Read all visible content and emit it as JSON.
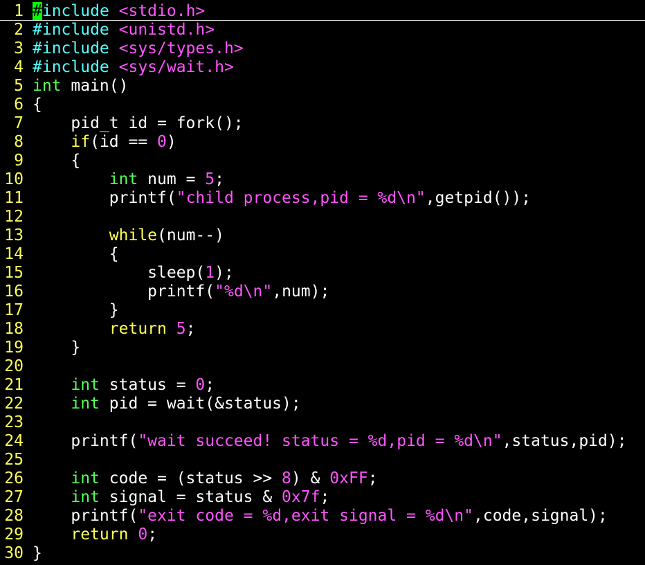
{
  "editor": {
    "theme": {
      "background": "#000000",
      "line_number": "#ffff55",
      "preproc": "#55ffff",
      "type": "#55ff55",
      "statement": "#ffff55",
      "string": "#ff55ff",
      "number": "#ff55ff",
      "normal": "#ffffff",
      "cursor": "#00ff00"
    },
    "cursor_line": 1,
    "lines": [
      {
        "n": "1",
        "tokens": [
          [
            "cursor",
            "#"
          ],
          [
            "pre",
            "include "
          ],
          [
            "str",
            "<stdio.h>"
          ]
        ]
      },
      {
        "n": "2",
        "tokens": [
          [
            "pre",
            "#include "
          ],
          [
            "str",
            "<unistd.h>"
          ]
        ]
      },
      {
        "n": "3",
        "tokens": [
          [
            "pre",
            "#include "
          ],
          [
            "str",
            "<sys/types.h>"
          ]
        ]
      },
      {
        "n": "4",
        "tokens": [
          [
            "pre",
            "#include "
          ],
          [
            "str",
            "<sys/wait.h>"
          ]
        ]
      },
      {
        "n": "5",
        "tokens": [
          [
            "type",
            "int"
          ],
          [
            "norm",
            " main()"
          ]
        ]
      },
      {
        "n": "6",
        "tokens": [
          [
            "norm",
            "{"
          ]
        ]
      },
      {
        "n": "7",
        "tokens": [
          [
            "norm",
            "    pid_t id = fork();"
          ]
        ]
      },
      {
        "n": "8",
        "tokens": [
          [
            "norm",
            "    "
          ],
          [
            "stmt",
            "if"
          ],
          [
            "norm",
            "(id == "
          ],
          [
            "num",
            "0"
          ],
          [
            "norm",
            ")"
          ]
        ]
      },
      {
        "n": "9",
        "tokens": [
          [
            "norm",
            "    {"
          ]
        ]
      },
      {
        "n": "10",
        "tokens": [
          [
            "norm",
            "        "
          ],
          [
            "type",
            "int"
          ],
          [
            "norm",
            " num = "
          ],
          [
            "num",
            "5"
          ],
          [
            "norm",
            ";"
          ]
        ]
      },
      {
        "n": "11",
        "tokens": [
          [
            "norm",
            "        printf("
          ],
          [
            "str",
            "\"child process,pid = "
          ],
          [
            "num",
            "%d\\n"
          ],
          [
            "str",
            "\""
          ],
          [
            "norm",
            ",getpid());"
          ]
        ]
      },
      {
        "n": "12",
        "tokens": []
      },
      {
        "n": "13",
        "tokens": [
          [
            "norm",
            "        "
          ],
          [
            "stmt",
            "while"
          ],
          [
            "norm",
            "(num--)"
          ]
        ]
      },
      {
        "n": "14",
        "tokens": [
          [
            "norm",
            "        {"
          ]
        ]
      },
      {
        "n": "15",
        "tokens": [
          [
            "norm",
            "            sleep("
          ],
          [
            "num",
            "1"
          ],
          [
            "norm",
            ");"
          ]
        ]
      },
      {
        "n": "16",
        "tokens": [
          [
            "norm",
            "            printf("
          ],
          [
            "str",
            "\""
          ],
          [
            "num",
            "%d\\n"
          ],
          [
            "str",
            "\""
          ],
          [
            "norm",
            ",num);"
          ]
        ]
      },
      {
        "n": "17",
        "tokens": [
          [
            "norm",
            "        }"
          ]
        ]
      },
      {
        "n": "18",
        "tokens": [
          [
            "norm",
            "        "
          ],
          [
            "stmt",
            "return"
          ],
          [
            "norm",
            " "
          ],
          [
            "num",
            "5"
          ],
          [
            "norm",
            ";"
          ]
        ]
      },
      {
        "n": "19",
        "tokens": [
          [
            "norm",
            "    }"
          ]
        ]
      },
      {
        "n": "20",
        "tokens": []
      },
      {
        "n": "21",
        "tokens": [
          [
            "norm",
            "    "
          ],
          [
            "type",
            "int"
          ],
          [
            "norm",
            " status = "
          ],
          [
            "num",
            "0"
          ],
          [
            "norm",
            ";"
          ]
        ]
      },
      {
        "n": "22",
        "tokens": [
          [
            "norm",
            "    "
          ],
          [
            "type",
            "int"
          ],
          [
            "norm",
            " pid = wait(&status);"
          ]
        ]
      },
      {
        "n": "23",
        "tokens": []
      },
      {
        "n": "24",
        "tokens": [
          [
            "norm",
            "    printf("
          ],
          [
            "str",
            "\"wait succeed! status = "
          ],
          [
            "num",
            "%d"
          ],
          [
            "str",
            ",pid = "
          ],
          [
            "num",
            "%d\\n"
          ],
          [
            "str",
            "\""
          ],
          [
            "norm",
            ",status,pid);"
          ]
        ]
      },
      {
        "n": "25",
        "tokens": []
      },
      {
        "n": "26",
        "tokens": [
          [
            "norm",
            "    "
          ],
          [
            "type",
            "int"
          ],
          [
            "norm",
            " code = (status >> "
          ],
          [
            "num",
            "8"
          ],
          [
            "norm",
            ") & "
          ],
          [
            "num",
            "0xFF"
          ],
          [
            "norm",
            ";"
          ]
        ]
      },
      {
        "n": "27",
        "tokens": [
          [
            "norm",
            "    "
          ],
          [
            "type",
            "int"
          ],
          [
            "norm",
            " signal = status & "
          ],
          [
            "num",
            "0x7f"
          ],
          [
            "norm",
            ";"
          ]
        ]
      },
      {
        "n": "28",
        "tokens": [
          [
            "norm",
            "    printf("
          ],
          [
            "str",
            "\"exit code = "
          ],
          [
            "num",
            "%d"
          ],
          [
            "str",
            ",exit signal = "
          ],
          [
            "num",
            "%d\\n"
          ],
          [
            "str",
            "\""
          ],
          [
            "norm",
            ",code,signal);"
          ]
        ]
      },
      {
        "n": "29",
        "tokens": [
          [
            "norm",
            "    "
          ],
          [
            "stmt",
            "return"
          ],
          [
            "norm",
            " "
          ],
          [
            "num",
            "0"
          ],
          [
            "norm",
            ";"
          ]
        ]
      },
      {
        "n": "30",
        "tokens": [
          [
            "norm",
            "}"
          ]
        ]
      }
    ]
  }
}
